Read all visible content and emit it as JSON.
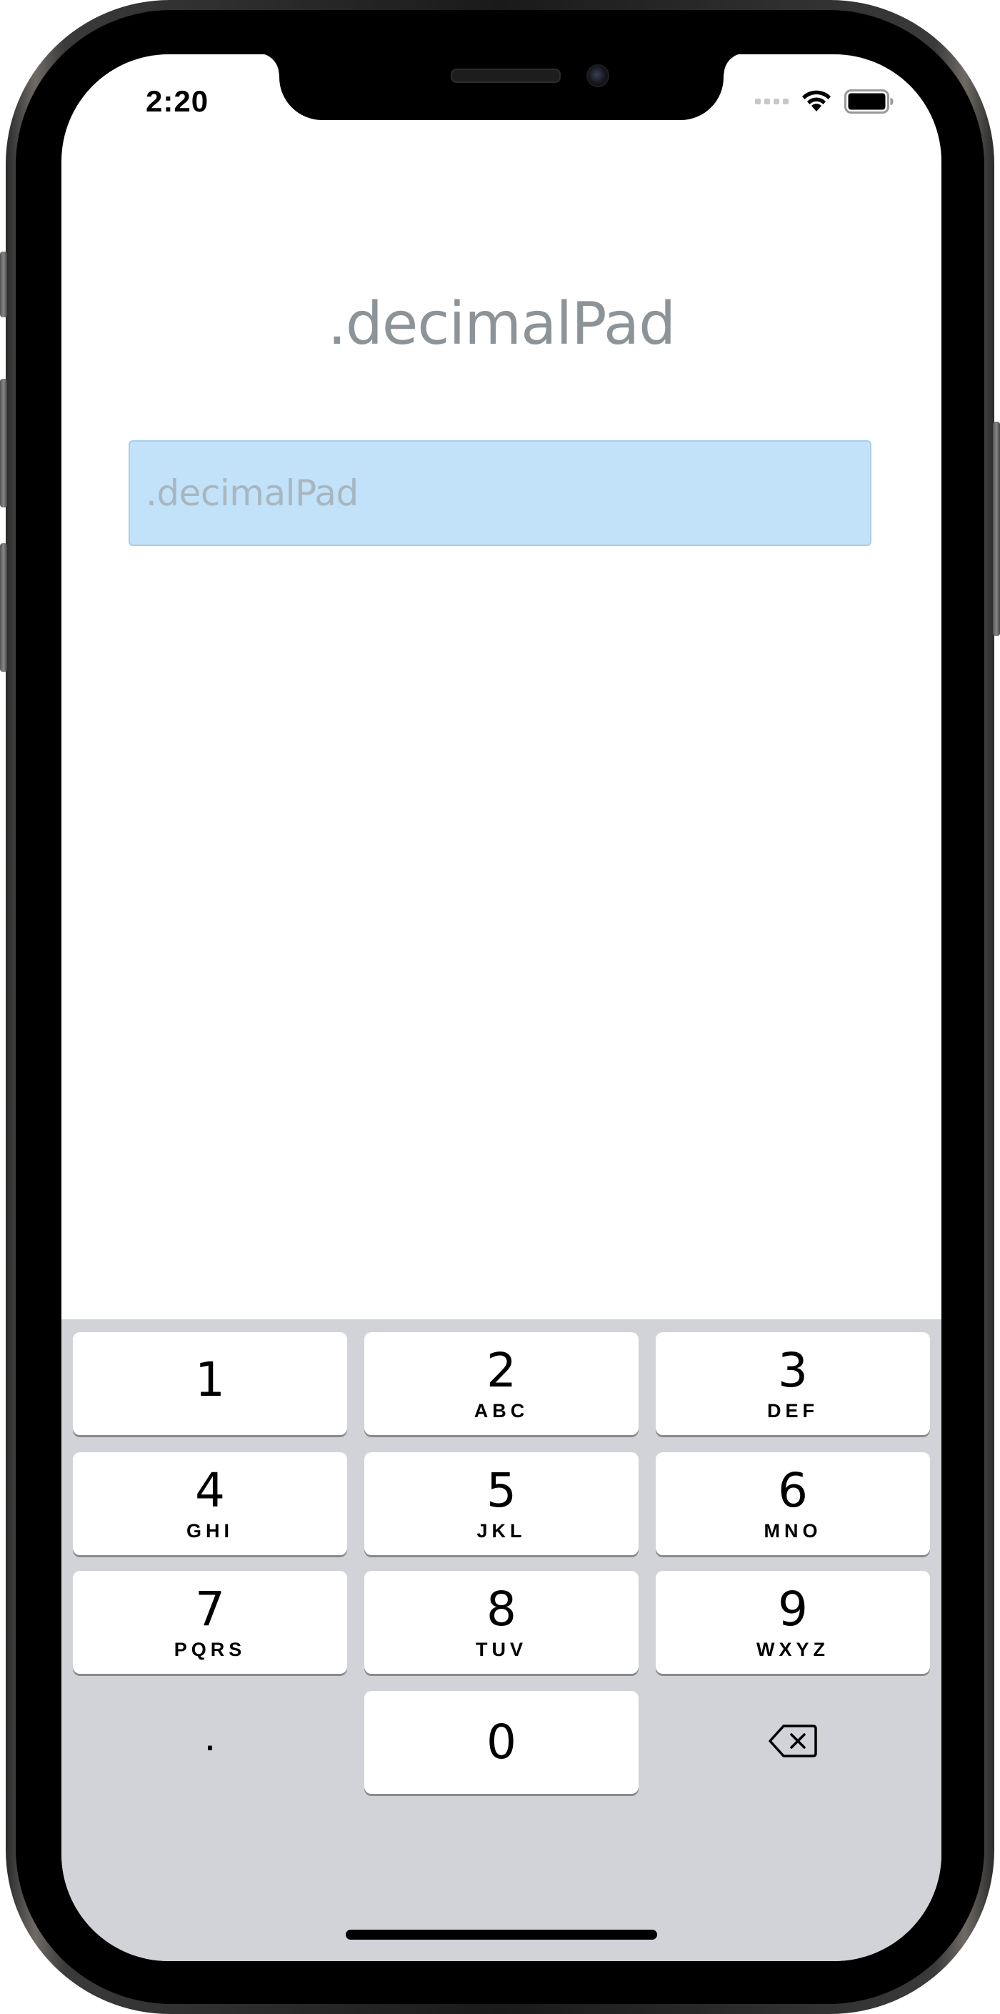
{
  "status_bar": {
    "time": "2:20",
    "icons": [
      "signal-dots-icon",
      "wifi-icon",
      "battery-icon"
    ]
  },
  "page": {
    "title": ".decimalPad",
    "text_field": {
      "value": "",
      "placeholder": ".decimalPad"
    }
  },
  "keyboard": {
    "type": "decimalPad",
    "keys": [
      {
        "digit": "1",
        "letters": ""
      },
      {
        "digit": "2",
        "letters": "ABC"
      },
      {
        "digit": "3",
        "letters": "DEF"
      },
      {
        "digit": "4",
        "letters": "GHI"
      },
      {
        "digit": "5",
        "letters": "JKL"
      },
      {
        "digit": "6",
        "letters": "MNO"
      },
      {
        "digit": "7",
        "letters": "PQRS"
      },
      {
        "digit": "8",
        "letters": "TUV"
      },
      {
        "digit": "9",
        "letters": "WXYZ"
      },
      {
        "digit": "0",
        "letters": ""
      }
    ],
    "decimal_key": ".",
    "delete_icon": "backspace-icon"
  },
  "colors": {
    "title_text": "#8d9499",
    "field_background": "#c1e2f8",
    "field_placeholder": "#a9b6bf",
    "keyboard_background": "#d1d3d9",
    "key_background": "#ffffff"
  }
}
